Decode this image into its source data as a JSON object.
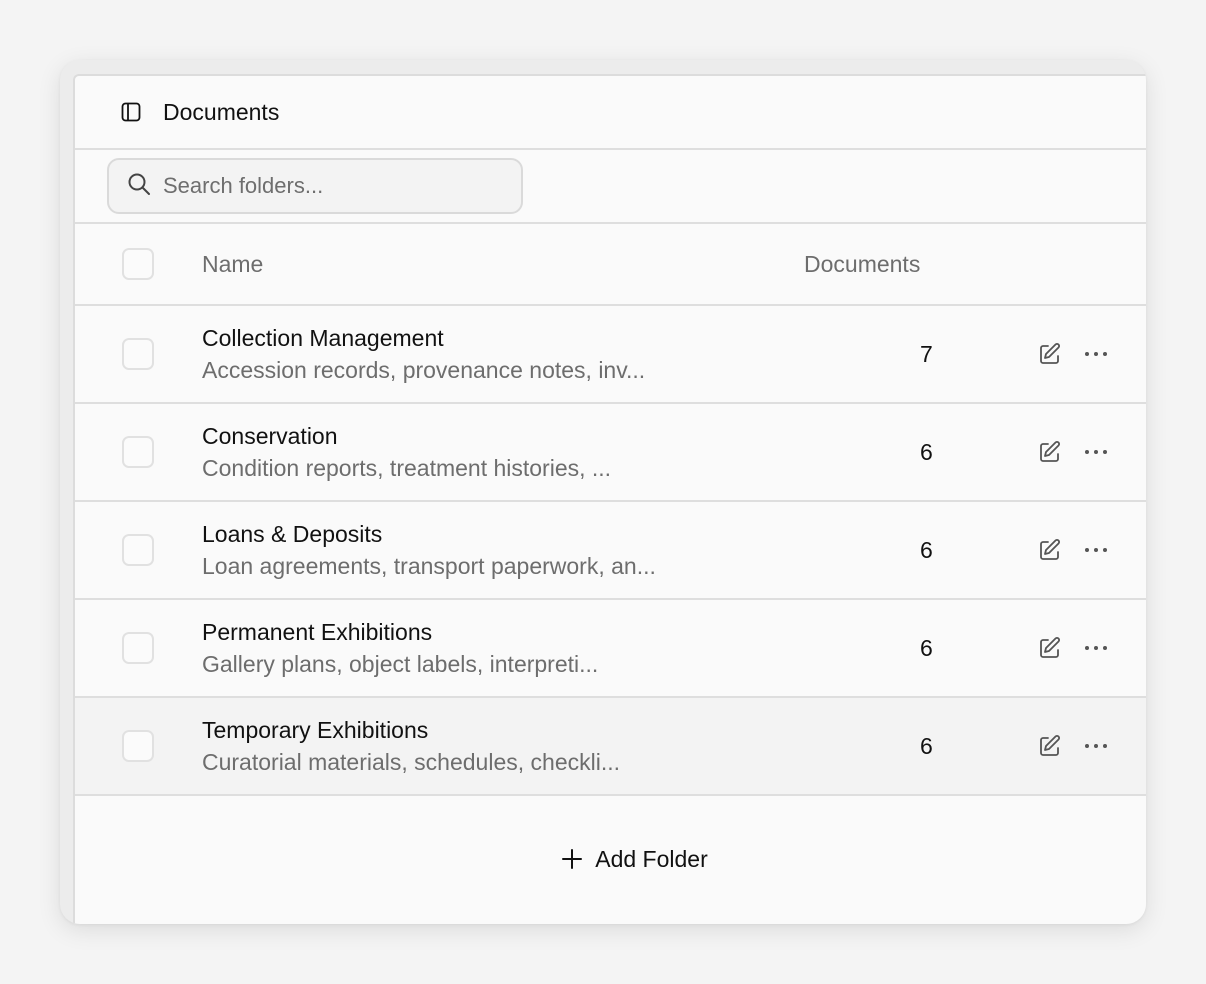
{
  "header": {
    "title": "Documents",
    "icon": "sidebar-toggle-icon"
  },
  "search": {
    "placeholder": "Search folders...",
    "value": ""
  },
  "table": {
    "columns": {
      "name": "Name",
      "documents": "Documents"
    },
    "rows": [
      {
        "name": "Collection Management",
        "description": "Accession records, provenance notes, inv...",
        "count": "7"
      },
      {
        "name": "Conservation",
        "description": "Condition reports, treatment histories, ...",
        "count": "6"
      },
      {
        "name": "Loans & Deposits",
        "description": "Loan agreements, transport paperwork, an...",
        "count": "6"
      },
      {
        "name": "Permanent Exhibitions",
        "description": "Gallery plans, object labels, interpreti...",
        "count": "6"
      },
      {
        "name": "Temporary Exhibitions",
        "description": "Curatorial materials, schedules, checkli...",
        "count": "6"
      }
    ]
  },
  "footer": {
    "add_label": "Add Folder"
  },
  "colors": {
    "text": "#111111",
    "muted": "#6d6d6d",
    "border": "#dedede",
    "background": "#fafafa"
  }
}
